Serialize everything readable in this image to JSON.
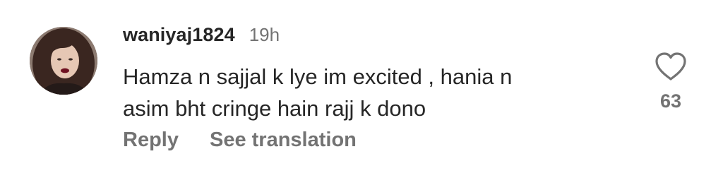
{
  "comment": {
    "username": "waniyaj1824",
    "time": "19h",
    "text_line1": "Hamza n sajjal k lye im excited , hania n",
    "text_line2": "asim bht cringe hain rajj k dono",
    "reply_label": "Reply",
    "translation_label": "See translation",
    "like_count": "63"
  },
  "icons": {
    "like": "heart-outline-icon",
    "avatar": "profile-photo"
  },
  "colors": {
    "primary_text": "#262626",
    "secondary_text": "#737373",
    "background": "#ffffff"
  }
}
